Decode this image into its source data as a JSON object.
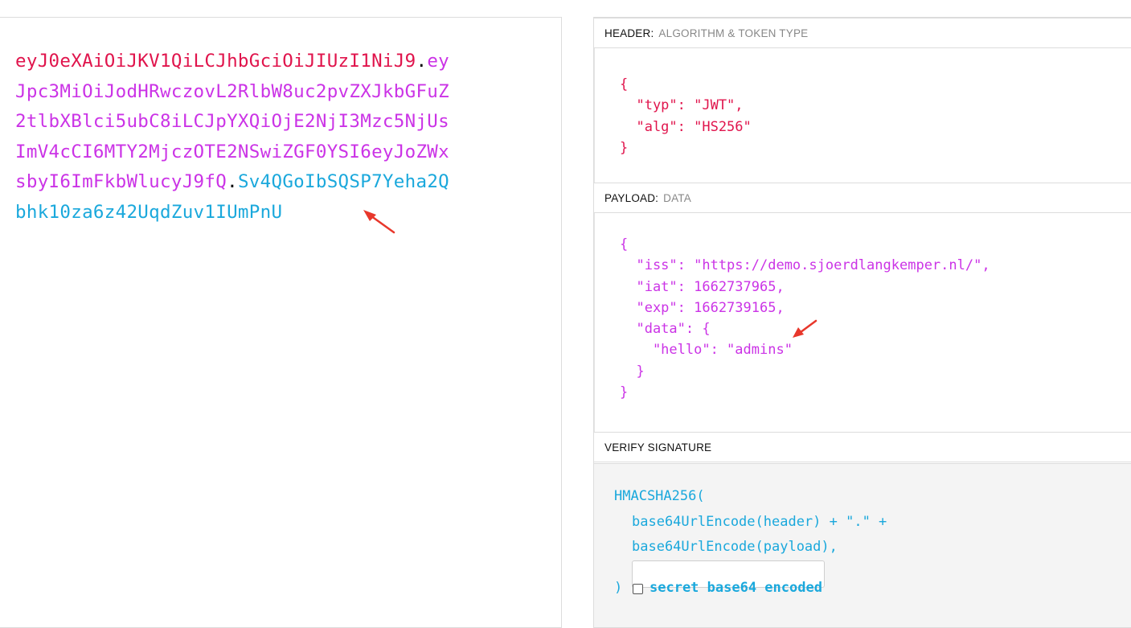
{
  "encoded": {
    "lines": [
      [
        {
          "t": "eyJ0eXAiOiJKV1QiLCJhbGciOiJIUzI1NiJ9",
          "c": "header"
        },
        {
          "t": ".",
          "c": "dot"
        },
        {
          "t": "ey",
          "c": "payload"
        }
      ],
      [
        {
          "t": "Jpc3MiOiJodHRwczovL2RlbW8uc2pvZXJkbGFuZ",
          "c": "payload"
        }
      ],
      [
        {
          "t": "2tlbXBlci5ubC8iLCJpYXQiOjE2NjI3Mzc5NjUs",
          "c": "payload"
        }
      ],
      [
        {
          "t": "ImV4cCI6MTY2MjczOTE2NSwiZGF0YSI6eyJoZWx",
          "c": "payload"
        }
      ],
      [
        {
          "t": "sbyI6ImFkbWlucyJ9fQ",
          "c": "payload"
        },
        {
          "t": ".",
          "c": "dot"
        },
        {
          "t": "Sv4QGoIbSQSP7Yeha2Q",
          "c": "sig"
        }
      ],
      [
        {
          "t": "bhk10za6z42UqdZuv1IUmPnU",
          "c": "sig"
        }
      ]
    ]
  },
  "header_section": {
    "title": "HEADER:",
    "subtitle": "ALGORITHM & TOKEN TYPE",
    "json_lines": [
      "{",
      "  \"typ\": \"JWT\",",
      "  \"alg\": \"HS256\"",
      "}"
    ]
  },
  "payload_section": {
    "title": "PAYLOAD:",
    "subtitle": "DATA",
    "json_lines": [
      "{",
      "  \"iss\": \"https://demo.sjoerdlangkemper.nl/\",",
      "  \"iat\": 1662737965,",
      "  \"exp\": 1662739165,",
      "  \"data\": {",
      "    \"hello\": \"admins\"",
      "  }",
      "}"
    ]
  },
  "signature_section": {
    "title": "VERIFY SIGNATURE",
    "fn_open": "HMACSHA256(",
    "line_header": "base64UrlEncode(header) + \".\" +",
    "line_payload": "base64UrlEncode(payload),",
    "secret_value": "",
    "fn_close": ")",
    "checkbox_label": "secret base64 encoded",
    "checkbox_checked": false
  },
  "colors": {
    "header": "#e0144c",
    "payload": "#cb33e6",
    "signature": "#1aa8dc",
    "annotation": "#e8372b"
  }
}
